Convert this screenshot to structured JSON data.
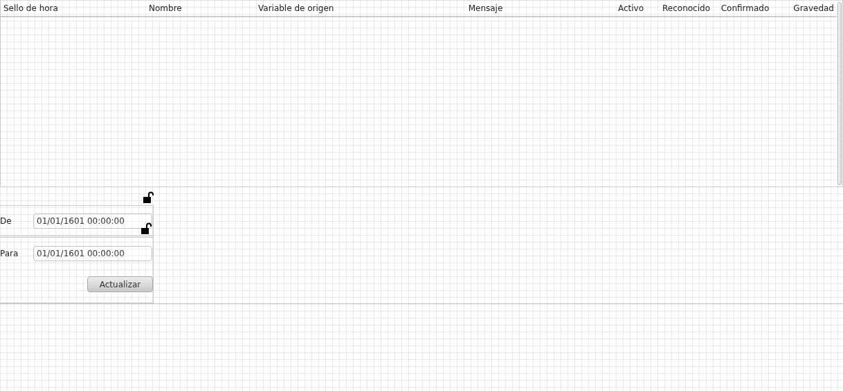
{
  "table": {
    "columns": [
      "Sello de hora",
      "Nombre",
      "Variable de origen",
      "Mensaje",
      "Activo",
      "Reconocido",
      "Confirmado",
      "Gravedad"
    ]
  },
  "filter": {
    "fields": [
      {
        "label": "De",
        "value": "01/01/1601 00:00:00",
        "locked": false
      },
      {
        "label": "Para",
        "value": "01/01/1601 00:00:00"
      }
    ],
    "panel_locked": false,
    "button": "Actualizar"
  }
}
